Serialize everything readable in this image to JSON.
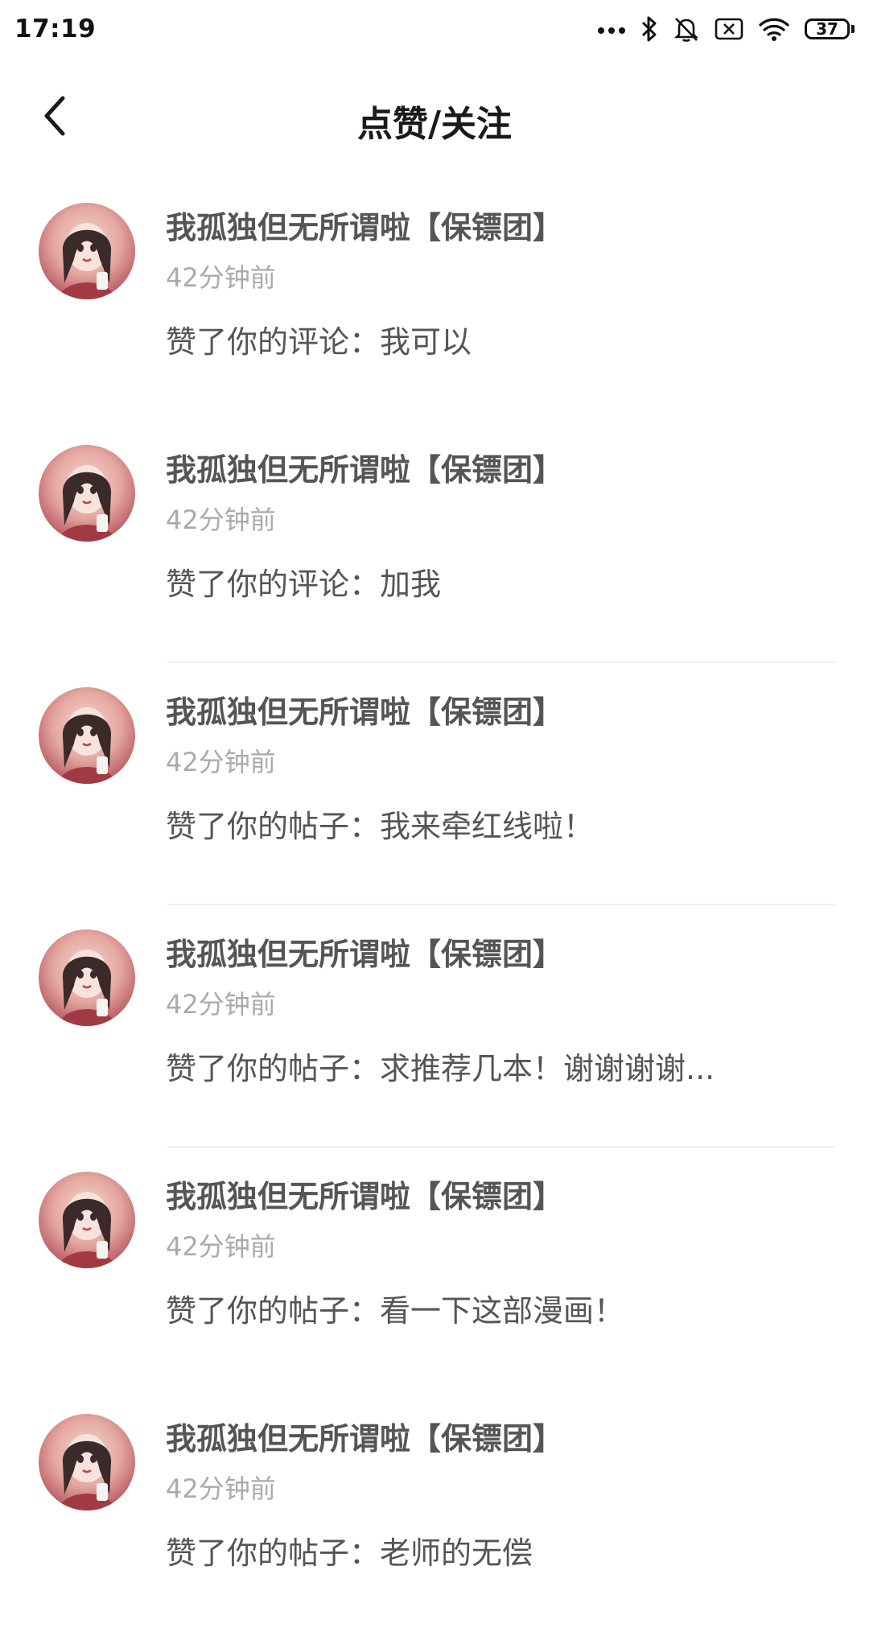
{
  "status_bar": {
    "time": "17:19",
    "battery": "37",
    "icons": [
      "more-dots-icon",
      "bluetooth-icon",
      "bell-muted-icon",
      "sim-off-icon",
      "wifi-icon",
      "battery-icon"
    ]
  },
  "header": {
    "back_icon": "chevron-left-icon",
    "title": "点赞/关注"
  },
  "notifications": [
    {
      "name": "我孤独但无所谓啦【保镖团】",
      "time": "42分钟前",
      "text": "赞了你的评论：我可以"
    },
    {
      "name": "我孤独但无所谓啦【保镖团】",
      "time": "42分钟前",
      "text": "赞了你的评论：加我"
    },
    {
      "name": "我孤独但无所谓啦【保镖团】",
      "time": "42分钟前",
      "text": "赞了你的帖子：我来牵红线啦！"
    },
    {
      "name": "我孤独但无所谓啦【保镖团】",
      "time": "42分钟前",
      "text": "赞了你的帖子：求推荐几本！谢谢谢谢..."
    },
    {
      "name": "我孤独但无所谓啦【保镖团】",
      "time": "42分钟前",
      "text": "赞了你的帖子：看一下这部漫画！"
    },
    {
      "name": "我孤独但无所谓啦【保镖团】",
      "time": "42分钟前",
      "text": "赞了你的帖子：老师的无偿"
    }
  ],
  "colors": {
    "name_text": "#555555",
    "time_text": "#aaaaaa",
    "divider": "#eeeeee",
    "avatar_tone": "#b5545d"
  }
}
